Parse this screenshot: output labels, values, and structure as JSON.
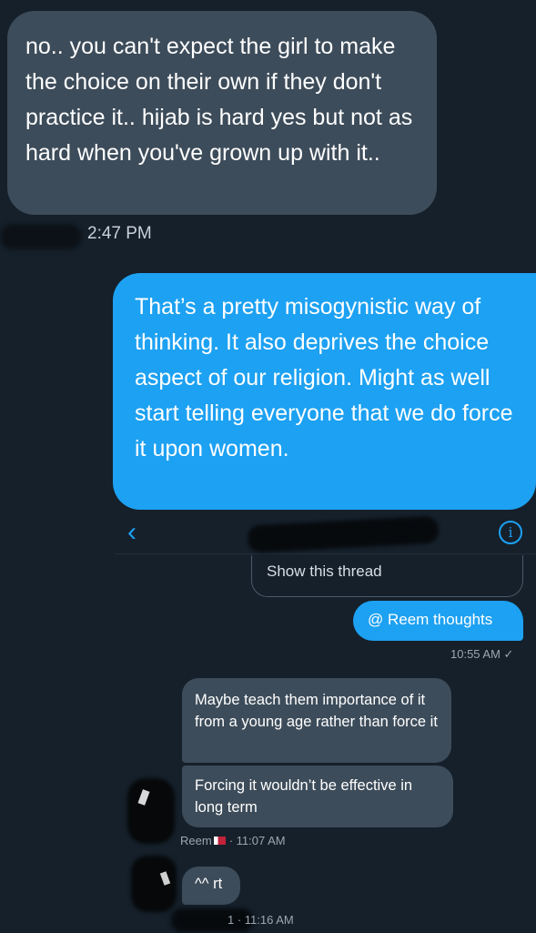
{
  "messages": {
    "received_top": "no.. you can't expect the girl to make the choice on their own if they don't practice it.. hijab is hard yes but not as hard when you've grown up with it..",
    "received_top_time": "2:47 PM",
    "sent_main": "That’s a pretty misogynistic way of thinking. It also deprives the choice aspect of our religion. Might as well start telling everyone that we do force it upon women."
  },
  "thread": {
    "show_thread_label": "Show this thread",
    "sent_reply": "@ Reem thoughts",
    "sent_reply_meta": "10:55 AM ✓",
    "reply_1": "Maybe teach them importance of it from a young age rather than force it",
    "reply_2": "Forcing it wouldn’t be effective in long term",
    "reply_2_sender": "Reem",
    "reply_2_time": "· 11:07 AM",
    "reply_3": "^^ rt",
    "reply_3_time": "1 · 11:16 AM"
  },
  "icons": {
    "back": "chevron-left-icon",
    "info": "info-icon"
  },
  "colors": {
    "background": "#15202b",
    "received_bubble": "#3d4c5a",
    "sent_bubble": "#1da1f2"
  }
}
